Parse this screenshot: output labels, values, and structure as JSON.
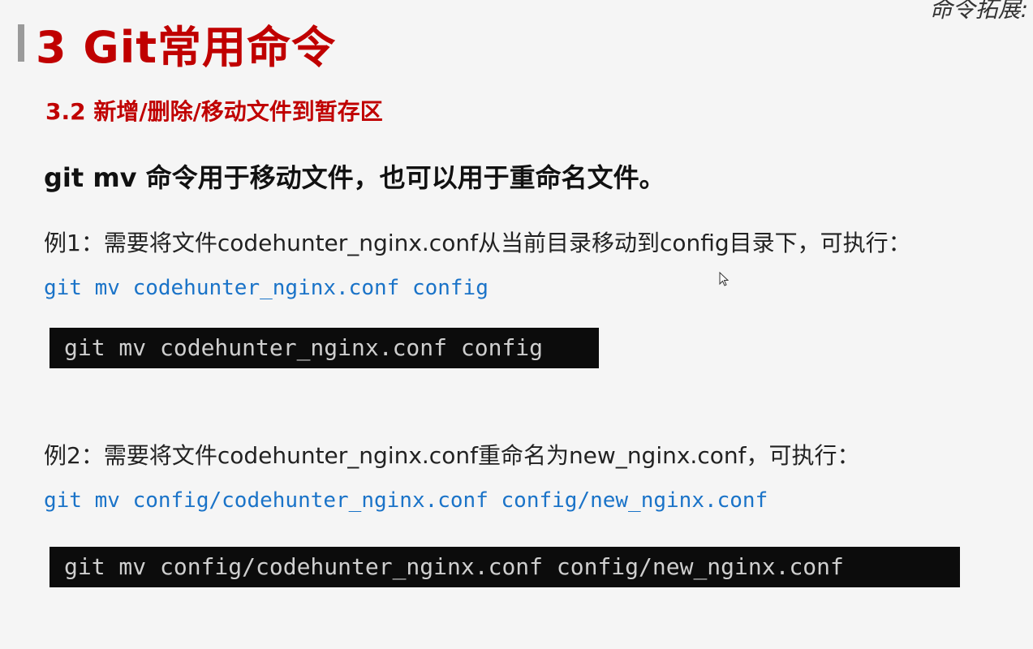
{
  "slide": {
    "title": "3 Git常用命令",
    "corner_note": "命令拓展:",
    "subtitle": "3.2 新增/删除/移动文件到暂存区",
    "lead": "git mv 命令用于移动文件，也可以用于重命名文件。",
    "examples": [
      {
        "text": "例1：需要将文件codehunter_nginx.conf从当前目录移动到config目录下，可执行：",
        "command": "git mv codehunter_nginx.conf config",
        "terminal": "git mv codehunter_nginx.conf config"
      },
      {
        "text": "例2：需要将文件codehunter_nginx.conf重命名为new_nginx.conf，可执行：",
        "command": "git mv config/codehunter_nginx.conf config/new_nginx.conf",
        "terminal": "git mv config/codehunter_nginx.conf config/new_nginx.conf"
      }
    ]
  },
  "colors": {
    "title_red": "#c00000",
    "command_blue": "#1a73c8",
    "terminal_bg": "#0c0c0c",
    "terminal_text": "#cfcfcf"
  },
  "icons": {
    "cursor": "mouse-pointer-icon"
  }
}
